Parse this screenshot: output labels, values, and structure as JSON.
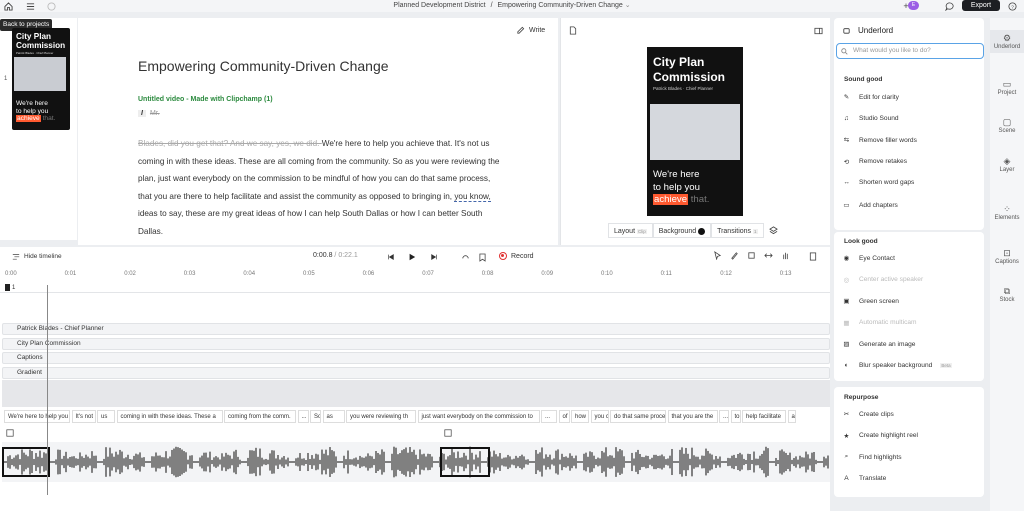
{
  "topbar": {
    "breadcrumb_project": "Planned Development District",
    "breadcrumb_sep": "/",
    "breadcrumb_doc": "Empowering Community-Driven Change",
    "export": "Export",
    "avatar": "E"
  },
  "tooltip": "Back to projects",
  "thumb": {
    "title": "City Plan Commission",
    "sub": "Patrick Blades · Chief Planner",
    "index": "1",
    "l1": "We're here",
    "l2": "to help you",
    "hl": "achieve",
    "tail": " that."
  },
  "editor": {
    "write": "Write",
    "title": "Empowering Community-Driven Change",
    "subtitle": "Untitled video - Made with Clipchamp (1)",
    "speaker_tag": "I",
    "speaker": "Mr.",
    "struck": "Blades, did you get that? And we say, yes, we did. ",
    "p1": "We're here to help you achieve that. It's not us coming in with these ideas. These are all coming from the community. So as you were reviewing the plan, just want everybody on the commission to be mindful of how you can do that same process, that you are there to help facilitate and assist the community as opposed to bringing in, ",
    "dashed": "you know,",
    "p2": " ideas to say, these are my great ideas of how I can help South Dallas or how I can better South Dallas."
  },
  "preview": {
    "title": "City Plan Commission",
    "sub": "Patrick Blades · Chief Planner",
    "l1": "We're here",
    "l2": "to help you",
    "hl": "achieve",
    "tail": " that.",
    "layout": "Layout",
    "clip": "Clip",
    "background": "Background",
    "transitions": "Transitions",
    "trans_count": "1"
  },
  "timeline": {
    "hide": "Hide timeline",
    "time": "0:00.8",
    "sep": "/",
    "total": "0:22.1",
    "record": "Record",
    "ticks": [
      "0:00",
      "0:01",
      "0:02",
      "0:03",
      "0:04",
      "0:05",
      "0:06",
      "0:07",
      "0:08",
      "0:09",
      "0:10",
      "0:11",
      "0:12",
      "0:13"
    ],
    "track_num": "1",
    "tracks": [
      "Patrick Blades - Chief Planner",
      "City Plan Commission",
      "Captions",
      "Gradient"
    ],
    "captions": [
      "We're here to help you achiev",
      "It's not",
      "us",
      "coming in with these ideas. These a",
      "coming from the comm.",
      "...",
      "So",
      "as",
      "you were reviewing th",
      "just want everybody on the commission to",
      "...",
      "of",
      "how",
      "you c",
      "do that same proces",
      "that you are the",
      "...",
      "to",
      "help facilitate",
      "a"
    ]
  },
  "panel": {
    "title": "Underlord",
    "search_ph": "What would you like to do?",
    "sound_title": "Sound good",
    "sound": [
      "Edit for clarity",
      "Studio Sound",
      "Remove filler words",
      "Remove retakes",
      "Shorten word gaps",
      "Add chapters"
    ],
    "look_title": "Look good",
    "look": [
      "Eye Contact",
      "Center active speaker",
      "Green screen",
      "Automatic multicam",
      "Generate an image",
      "Blur speaker background"
    ],
    "beta": "Beta",
    "repurpose_title": "Repurpose",
    "repurpose": [
      "Create clips",
      "Create highlight reel",
      "Find highlights",
      "Translate"
    ]
  },
  "rail": [
    "Underlord",
    "Project",
    "Scene",
    "Layer",
    "Elements",
    "Captions",
    "Stock"
  ],
  "colors": {
    "accent": "#ff5a30",
    "green": "#2b8a3e",
    "record": "#e03131"
  }
}
